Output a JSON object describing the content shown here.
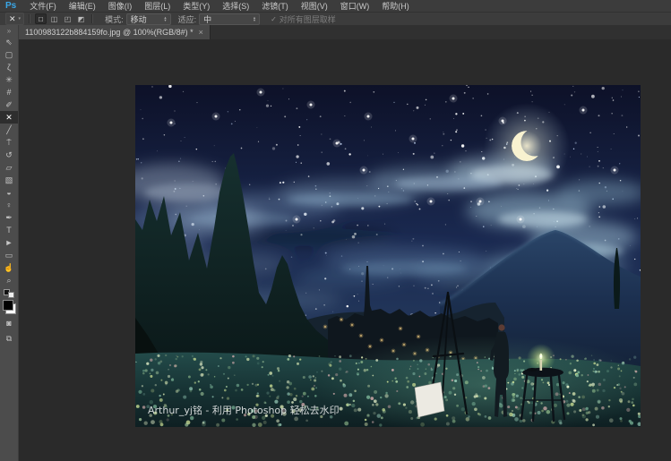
{
  "menu_bar": {
    "logo": "Ps",
    "items": [
      "文件(F)",
      "编辑(E)",
      "图像(I)",
      "图层(L)",
      "类型(Y)",
      "选择(S)",
      "滤镜(T)",
      "视图(V)",
      "窗口(W)",
      "帮助(H)"
    ]
  },
  "options_bar": {
    "tool": {
      "name": "content-aware-move-tool",
      "glyph": "✕",
      "caret": "▾"
    },
    "combine_modes": [
      {
        "name": "new-selection",
        "glyph": "□",
        "active": true
      },
      {
        "name": "add-to-selection",
        "glyph": "◫",
        "active": false
      },
      {
        "name": "subtract-from-selection",
        "glyph": "◰",
        "active": false
      },
      {
        "name": "intersect-selection",
        "glyph": "◩",
        "active": false
      }
    ],
    "mode": {
      "label": "模式:",
      "value": "移动"
    },
    "adaptation": {
      "label": "适应:",
      "value": "中"
    },
    "sample_all_layers": {
      "label": "对所有图层取样",
      "checked": true,
      "check_glyph": "✓"
    },
    "select_arrow_up": "▴",
    "select_arrow_down": "▾"
  },
  "tab_bar": {
    "collapse_glyph": "»",
    "tabs": [
      {
        "title": "1100983122b884159fo.jpg @ 100%(RGB/8#) *",
        "close_glyph": "×",
        "active": true
      }
    ]
  },
  "toolbar": {
    "items": [
      {
        "name": "move-tool",
        "glyph": "⇖"
      },
      {
        "name": "rectangular-marquee-tool",
        "glyph": "▢"
      },
      {
        "name": "lasso-tool",
        "glyph": "ζ"
      },
      {
        "name": "quick-selection-tool",
        "glyph": "✳"
      },
      {
        "name": "crop-tool",
        "glyph": "#"
      },
      {
        "name": "eyedropper-tool",
        "glyph": "✐"
      },
      {
        "name": "content-aware-move-tool",
        "glyph": "✕",
        "selected": true
      },
      {
        "name": "brush-tool",
        "glyph": "╱"
      },
      {
        "name": "clone-stamp-tool",
        "glyph": "⍑"
      },
      {
        "name": "history-brush-tool",
        "glyph": "↺"
      },
      {
        "name": "eraser-tool",
        "glyph": "▱"
      },
      {
        "name": "gradient-tool",
        "glyph": "▧"
      },
      {
        "name": "blur-tool",
        "glyph": "◒"
      },
      {
        "name": "dodge-tool",
        "glyph": "♀"
      },
      {
        "name": "pen-tool",
        "glyph": "✒"
      },
      {
        "name": "type-tool",
        "glyph": "T"
      },
      {
        "name": "path-selection-tool",
        "glyph": "►"
      },
      {
        "name": "rectangle-tool",
        "glyph": "▭"
      },
      {
        "name": "hand-tool",
        "glyph": "☝"
      },
      {
        "name": "zoom-tool",
        "glyph": "⌕"
      }
    ],
    "foreground_color": "#000000",
    "background_color": "#ffffff",
    "extras": [
      {
        "name": "quick-mask-mode",
        "glyph": "◙"
      },
      {
        "name": "screen-mode",
        "glyph": "⧉"
      }
    ]
  },
  "document": {
    "watermark": "Arthur_yj铭 - 利用 Photoshop 轻松去水印"
  },
  "colors": {
    "accent_blue": "#3aa8e8",
    "bar_bg": "#3c3c3c",
    "toolbar_bg": "#4c4c4c",
    "canvas_bg": "#2a2a2a",
    "active_tab_bg": "#484848"
  }
}
